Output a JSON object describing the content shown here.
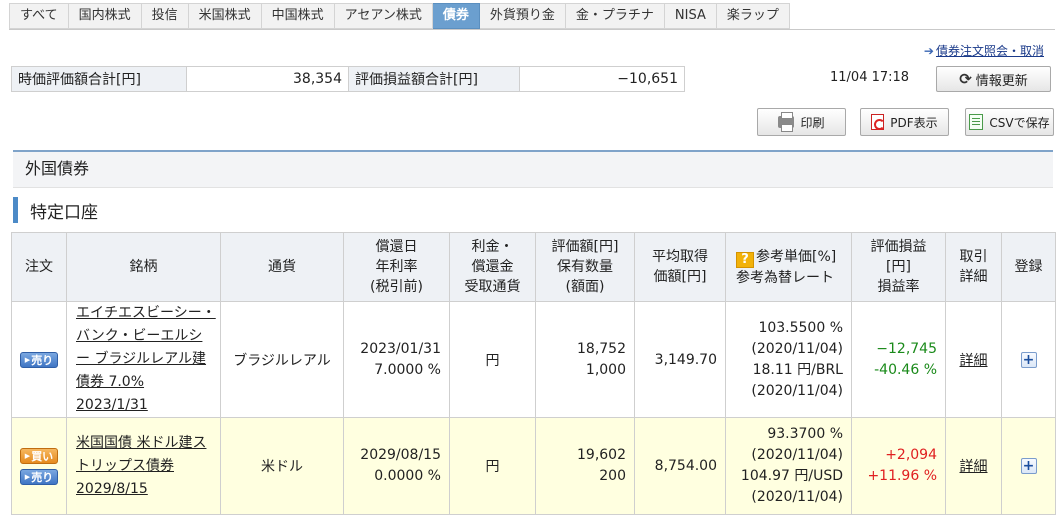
{
  "tabs": [
    "すべて",
    "国内株式",
    "投信",
    "米国株式",
    "中国株式",
    "アセアン株式",
    "債券",
    "外貨預り金",
    "金・プラチナ",
    "NISA",
    "楽ラップ"
  ],
  "active_tab": "債券",
  "order_link": "債券注文照会・取消",
  "summary": {
    "market_value_label": "時価評価額合計[円]",
    "market_value": "38,354",
    "unrealized_label": "評価損益額合計[円]",
    "unrealized": "−10,651"
  },
  "timestamp": "11/04 17:18",
  "buttons": {
    "refresh": "情報更新",
    "print": "印刷",
    "pdf": "PDF表示",
    "csv": "CSVで保存"
  },
  "section_title": "外国債券",
  "account_title": "特定口座",
  "columns": {
    "order": "注文",
    "name": "銘柄",
    "currency": "通貨",
    "redemption": [
      "償還日",
      "年利率",
      "(税引前)"
    ],
    "receipt": [
      "利金・",
      "償還金",
      "受取通貨"
    ],
    "valuation": [
      "評価額[円]",
      "保有数量",
      "(額面)"
    ],
    "avg_cost": [
      "平均取得",
      "価額[円]"
    ],
    "ref_price": [
      "参考単価[%]",
      "参考為替レート"
    ],
    "pl": [
      "評価損益",
      "[円]",
      "損益率"
    ],
    "trade_detail": [
      "取引",
      "詳細"
    ],
    "register": "登録"
  },
  "order_labels": {
    "sell": "売り",
    "buy": "買い"
  },
  "rows": [
    {
      "name": "エイチエスビーシー・バンク・ビーエルシー ブラジルレアル建債券 7.0% 2023/1/31",
      "currency": "ブラジルレアル",
      "redemption_date": "2023/01/31",
      "rate": "7.0000 %",
      "receipt_currency": "円",
      "valuation": "18,752",
      "quantity": "1,000",
      "avg_cost": "3,149.70",
      "ref_price": "103.5500 %",
      "ref_price_date": "(2020/11/04)",
      "ref_fx": "18.11 円/BRL",
      "ref_fx_date": "(2020/11/04)",
      "pl_amount": "−12,745",
      "pl_rate": "-40.46 %",
      "detail": "詳細"
    },
    {
      "name": "米国国債 米ドル建ストリップス債券 2029/8/15",
      "currency": "米ドル",
      "redemption_date": "2029/08/15",
      "rate": "0.0000 %",
      "receipt_currency": "円",
      "valuation": "19,602",
      "quantity": "200",
      "avg_cost": "8,754.00",
      "ref_price": "93.3700 %",
      "ref_price_date": "(2020/11/04)",
      "ref_fx": "104.97 円/USD",
      "ref_fx_date": "(2020/11/04)",
      "pl_amount": "+2,094",
      "pl_rate": "+11.96 %",
      "detail": "詳細"
    }
  ],
  "colors": {
    "active_tab": "#6b9fcf",
    "positive": "#1a8a1a",
    "negative": "#e02020",
    "highlight_row": "#ffffe0"
  }
}
